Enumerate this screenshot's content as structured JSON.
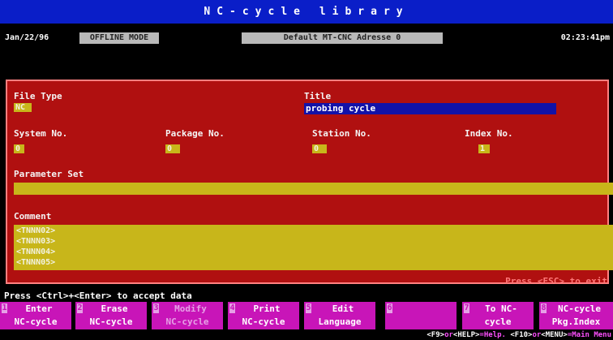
{
  "window": {
    "title": "NC-cycle library"
  },
  "status": {
    "date": "Jan/22/96",
    "mode": "OFFLINE MODE",
    "address": "Default MT-CNC Adresse 0",
    "clock": "02:23:41pm"
  },
  "form": {
    "file_type_label": "File Type",
    "file_type_value": "NC",
    "title_label": "Title",
    "title_value": "probing cycle",
    "system_no_label": "System No.",
    "system_no_value": "0",
    "package_no_label": "Package No.",
    "package_no_value": "0",
    "station_no_label": "Station No.",
    "station_no_value": "0",
    "index_no_label": "Index No.",
    "index_no_value": "1",
    "parameter_set_label": "Parameter Set",
    "parameter_set_value": "",
    "comment_label": "Comment",
    "comment_lines": [
      "<TNNN02>",
      "<TNNN03>",
      "<TNNN04>",
      "<TNNN05>"
    ],
    "esc_hint": "Press <ESC> to exit"
  },
  "footer": {
    "accept_hint": "Press <Ctrl>+<Enter> to accept data",
    "fkeys": [
      {
        "num": "1",
        "line1": "Enter",
        "line2": "NC-cycle",
        "enabled": true
      },
      {
        "num": "2",
        "line1": "Erase",
        "line2": "NC-cycle",
        "enabled": true
      },
      {
        "num": "3",
        "line1": "Modify",
        "line2": "NC-cycle",
        "enabled": false
      },
      {
        "num": "4",
        "line1": "Print",
        "line2": "NC-cycle",
        "enabled": true
      },
      {
        "num": "5",
        "line1": "Edit",
        "line2": "Language",
        "enabled": true
      },
      {
        "num": "6",
        "line1": "",
        "line2": "",
        "enabled": false
      },
      {
        "num": "7",
        "line1": "To NC-",
        "line2": "cycle",
        "enabled": true
      },
      {
        "num": "8",
        "line1": "NC-cycle",
        "line2": "Pkg.Index",
        "enabled": true
      }
    ],
    "help": {
      "f9": "<F9>",
      "or1": "or",
      "help_key": "<HELP>",
      "help_text": "=Help.",
      "f10": "<F10>",
      "or2": "or",
      "menu_key": "<MENU>",
      "menu_text": "=Main Menu"
    }
  },
  "colors": {
    "title_bar": "#0a1ec8",
    "panel": "#b01010",
    "field": "#c8b61a",
    "title_field": "#1212a8",
    "fkey": "#c815b8"
  }
}
